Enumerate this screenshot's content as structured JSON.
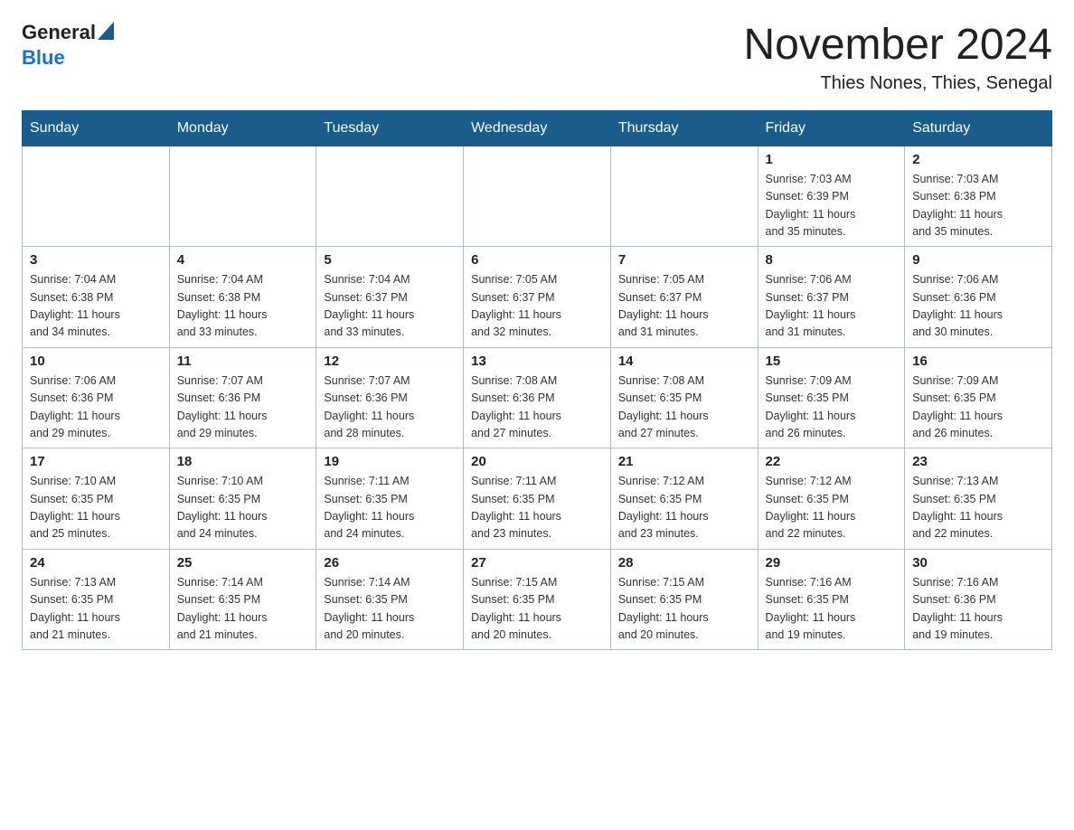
{
  "header": {
    "logo_general": "General",
    "logo_blue": "Blue",
    "month_title": "November 2024",
    "location": "Thies Nones, Thies, Senegal"
  },
  "weekdays": [
    "Sunday",
    "Monday",
    "Tuesday",
    "Wednesday",
    "Thursday",
    "Friday",
    "Saturday"
  ],
  "weeks": [
    [
      {
        "day": "",
        "info": ""
      },
      {
        "day": "",
        "info": ""
      },
      {
        "day": "",
        "info": ""
      },
      {
        "day": "",
        "info": ""
      },
      {
        "day": "",
        "info": ""
      },
      {
        "day": "1",
        "info": "Sunrise: 7:03 AM\nSunset: 6:39 PM\nDaylight: 11 hours\nand 35 minutes."
      },
      {
        "day": "2",
        "info": "Sunrise: 7:03 AM\nSunset: 6:38 PM\nDaylight: 11 hours\nand 35 minutes."
      }
    ],
    [
      {
        "day": "3",
        "info": "Sunrise: 7:04 AM\nSunset: 6:38 PM\nDaylight: 11 hours\nand 34 minutes."
      },
      {
        "day": "4",
        "info": "Sunrise: 7:04 AM\nSunset: 6:38 PM\nDaylight: 11 hours\nand 33 minutes."
      },
      {
        "day": "5",
        "info": "Sunrise: 7:04 AM\nSunset: 6:37 PM\nDaylight: 11 hours\nand 33 minutes."
      },
      {
        "day": "6",
        "info": "Sunrise: 7:05 AM\nSunset: 6:37 PM\nDaylight: 11 hours\nand 32 minutes."
      },
      {
        "day": "7",
        "info": "Sunrise: 7:05 AM\nSunset: 6:37 PM\nDaylight: 11 hours\nand 31 minutes."
      },
      {
        "day": "8",
        "info": "Sunrise: 7:06 AM\nSunset: 6:37 PM\nDaylight: 11 hours\nand 31 minutes."
      },
      {
        "day": "9",
        "info": "Sunrise: 7:06 AM\nSunset: 6:36 PM\nDaylight: 11 hours\nand 30 minutes."
      }
    ],
    [
      {
        "day": "10",
        "info": "Sunrise: 7:06 AM\nSunset: 6:36 PM\nDaylight: 11 hours\nand 29 minutes."
      },
      {
        "day": "11",
        "info": "Sunrise: 7:07 AM\nSunset: 6:36 PM\nDaylight: 11 hours\nand 29 minutes."
      },
      {
        "day": "12",
        "info": "Sunrise: 7:07 AM\nSunset: 6:36 PM\nDaylight: 11 hours\nand 28 minutes."
      },
      {
        "day": "13",
        "info": "Sunrise: 7:08 AM\nSunset: 6:36 PM\nDaylight: 11 hours\nand 27 minutes."
      },
      {
        "day": "14",
        "info": "Sunrise: 7:08 AM\nSunset: 6:35 PM\nDaylight: 11 hours\nand 27 minutes."
      },
      {
        "day": "15",
        "info": "Sunrise: 7:09 AM\nSunset: 6:35 PM\nDaylight: 11 hours\nand 26 minutes."
      },
      {
        "day": "16",
        "info": "Sunrise: 7:09 AM\nSunset: 6:35 PM\nDaylight: 11 hours\nand 26 minutes."
      }
    ],
    [
      {
        "day": "17",
        "info": "Sunrise: 7:10 AM\nSunset: 6:35 PM\nDaylight: 11 hours\nand 25 minutes."
      },
      {
        "day": "18",
        "info": "Sunrise: 7:10 AM\nSunset: 6:35 PM\nDaylight: 11 hours\nand 24 minutes."
      },
      {
        "day": "19",
        "info": "Sunrise: 7:11 AM\nSunset: 6:35 PM\nDaylight: 11 hours\nand 24 minutes."
      },
      {
        "day": "20",
        "info": "Sunrise: 7:11 AM\nSunset: 6:35 PM\nDaylight: 11 hours\nand 23 minutes."
      },
      {
        "day": "21",
        "info": "Sunrise: 7:12 AM\nSunset: 6:35 PM\nDaylight: 11 hours\nand 23 minutes."
      },
      {
        "day": "22",
        "info": "Sunrise: 7:12 AM\nSunset: 6:35 PM\nDaylight: 11 hours\nand 22 minutes."
      },
      {
        "day": "23",
        "info": "Sunrise: 7:13 AM\nSunset: 6:35 PM\nDaylight: 11 hours\nand 22 minutes."
      }
    ],
    [
      {
        "day": "24",
        "info": "Sunrise: 7:13 AM\nSunset: 6:35 PM\nDaylight: 11 hours\nand 21 minutes."
      },
      {
        "day": "25",
        "info": "Sunrise: 7:14 AM\nSunset: 6:35 PM\nDaylight: 11 hours\nand 21 minutes."
      },
      {
        "day": "26",
        "info": "Sunrise: 7:14 AM\nSunset: 6:35 PM\nDaylight: 11 hours\nand 20 minutes."
      },
      {
        "day": "27",
        "info": "Sunrise: 7:15 AM\nSunset: 6:35 PM\nDaylight: 11 hours\nand 20 minutes."
      },
      {
        "day": "28",
        "info": "Sunrise: 7:15 AM\nSunset: 6:35 PM\nDaylight: 11 hours\nand 20 minutes."
      },
      {
        "day": "29",
        "info": "Sunrise: 7:16 AM\nSunset: 6:35 PM\nDaylight: 11 hours\nand 19 minutes."
      },
      {
        "day": "30",
        "info": "Sunrise: 7:16 AM\nSunset: 6:36 PM\nDaylight: 11 hours\nand 19 minutes."
      }
    ]
  ]
}
